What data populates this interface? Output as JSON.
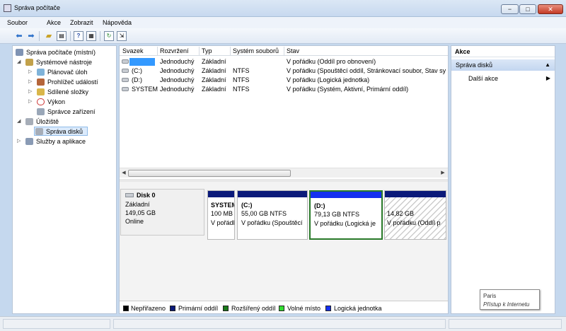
{
  "window": {
    "title": "Správa počítače",
    "btn_min": "−",
    "btn_max": "□",
    "btn_close": "✕"
  },
  "menu": {
    "items": [
      "Soubor",
      "Akce",
      "Zobrazit",
      "Nápověda"
    ]
  },
  "toolbar": {
    "icons": [
      "back-arrow-icon",
      "forward-arrow-icon",
      "up-folder-icon",
      "show-hide-tree-icon",
      "help-icon",
      "properties-icon",
      "refresh-icon",
      "export-icon"
    ]
  },
  "tree": {
    "root": "Správa počítače (místní)",
    "items": [
      "Systémové nástroje",
      "Plánovač úloh",
      "Prohlížeč událostí",
      "Sdílené složky",
      "Výkon",
      "Správce zařízení",
      "Úložiště",
      "Správa disků",
      "Služby a aplikace"
    ]
  },
  "volumes": {
    "headers": [
      "Svazek",
      "Rozvržení",
      "Typ",
      "Systém souborů",
      "Stav"
    ],
    "rows": [
      {
        "volume": "",
        "layout": "Jednoduchý",
        "type": "Základní",
        "fs": "",
        "status": "V pořádku (Oddíl pro obnovení)"
      },
      {
        "volume": "(C:)",
        "layout": "Jednoduchý",
        "type": "Základní",
        "fs": "NTFS",
        "status": "V pořádku (Spouštěcí oddíl, Stránkovací soubor, Stav sy"
      },
      {
        "volume": "(D:)",
        "layout": "Jednoduchý",
        "type": "Základní",
        "fs": "NTFS",
        "status": "V pořádku (Logická jednotka)"
      },
      {
        "volume": "SYSTEM",
        "layout": "Jednoduchý",
        "type": "Základní",
        "fs": "NTFS",
        "status": "V pořádku (Systém, Aktivní, Primární oddíl)"
      }
    ]
  },
  "disk": {
    "name": "Disk 0",
    "type": "Základní",
    "size": "149,05 GB",
    "state": "Online",
    "partitions": [
      {
        "l1": "SYSTEM",
        "l2": "100 MB",
        "l3": "V pořádku"
      },
      {
        "l1": "(C:)",
        "l2": "55,00 GB NTFS",
        "l3": "V pořádku (Spouštěcí"
      },
      {
        "l1": "(D:)",
        "l2": "79,13 GB NTFS",
        "l3": "V pořádku (Logická je"
      },
      {
        "l1": "",
        "l2": "14,82 GB",
        "l3": "V pořádku (Oddíl p"
      }
    ]
  },
  "legend": {
    "items": [
      {
        "label": "Nepřiřazeno",
        "color": "#000000"
      },
      {
        "label": "Primární oddíl",
        "color": "#0b1a7a"
      },
      {
        "label": "Rozšířený oddíl",
        "color": "#1a7a1a"
      },
      {
        "label": "Volné místo",
        "color": "#33dd33"
      },
      {
        "label": "Logická jednotka",
        "color": "#1530f0"
      }
    ]
  },
  "actions": {
    "header": "Akce",
    "section": "Správa disků",
    "item": "Další akce"
  },
  "tooltip": {
    "line1": "Paris",
    "line2": "Přístup k Internetu"
  }
}
